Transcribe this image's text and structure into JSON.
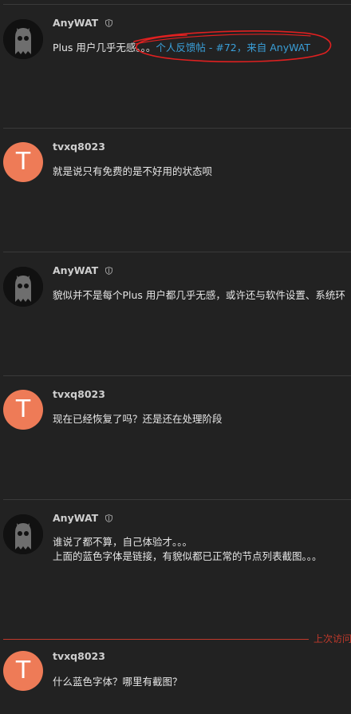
{
  "posts": [
    {
      "username": "AnyWAT",
      "avatar": "ghost-avatar",
      "moderator": true,
      "lines": [
        "Plus 用户几乎无感。。。"
      ],
      "link_text": "个人反馈帖 - #72，来自 AnyWAT"
    },
    {
      "username": "tvxq8023",
      "avatar": "letter-avatar",
      "avatar_letter": "T",
      "moderator": false,
      "lines": [
        "就是说只有免费的是不好用的状态呗"
      ]
    },
    {
      "username": "AnyWAT",
      "avatar": "ghost-avatar",
      "moderator": true,
      "lines": [
        "貌似并不是每个Plus 用户都几乎无感，或许还与软件设置、系统环"
      ]
    },
    {
      "username": "tvxq8023",
      "avatar": "letter-avatar",
      "avatar_letter": "T",
      "moderator": false,
      "lines": [
        "现在已经恢复了吗？还是还在处理阶段"
      ]
    },
    {
      "username": "AnyWAT",
      "avatar": "ghost-avatar",
      "moderator": true,
      "lines": [
        "谁说了都不算，自己体验才。。。",
        "上面的蓝色字体是链接，有貌似都已正常的节点列表截图。。。"
      ]
    },
    {
      "username": "tvxq8023",
      "avatar": "letter-avatar",
      "avatar_letter": "T",
      "moderator": false,
      "lines": [
        "什么蓝色字体？哪里有截图？"
      ]
    }
  ],
  "last_visit_label": "上次访问",
  "colors": {
    "background": "#222222",
    "link": "#3a9fd8",
    "avatar_letter_bg": "#ee7b57",
    "last_visit": "#c0392b",
    "annotation": "#e02020"
  }
}
